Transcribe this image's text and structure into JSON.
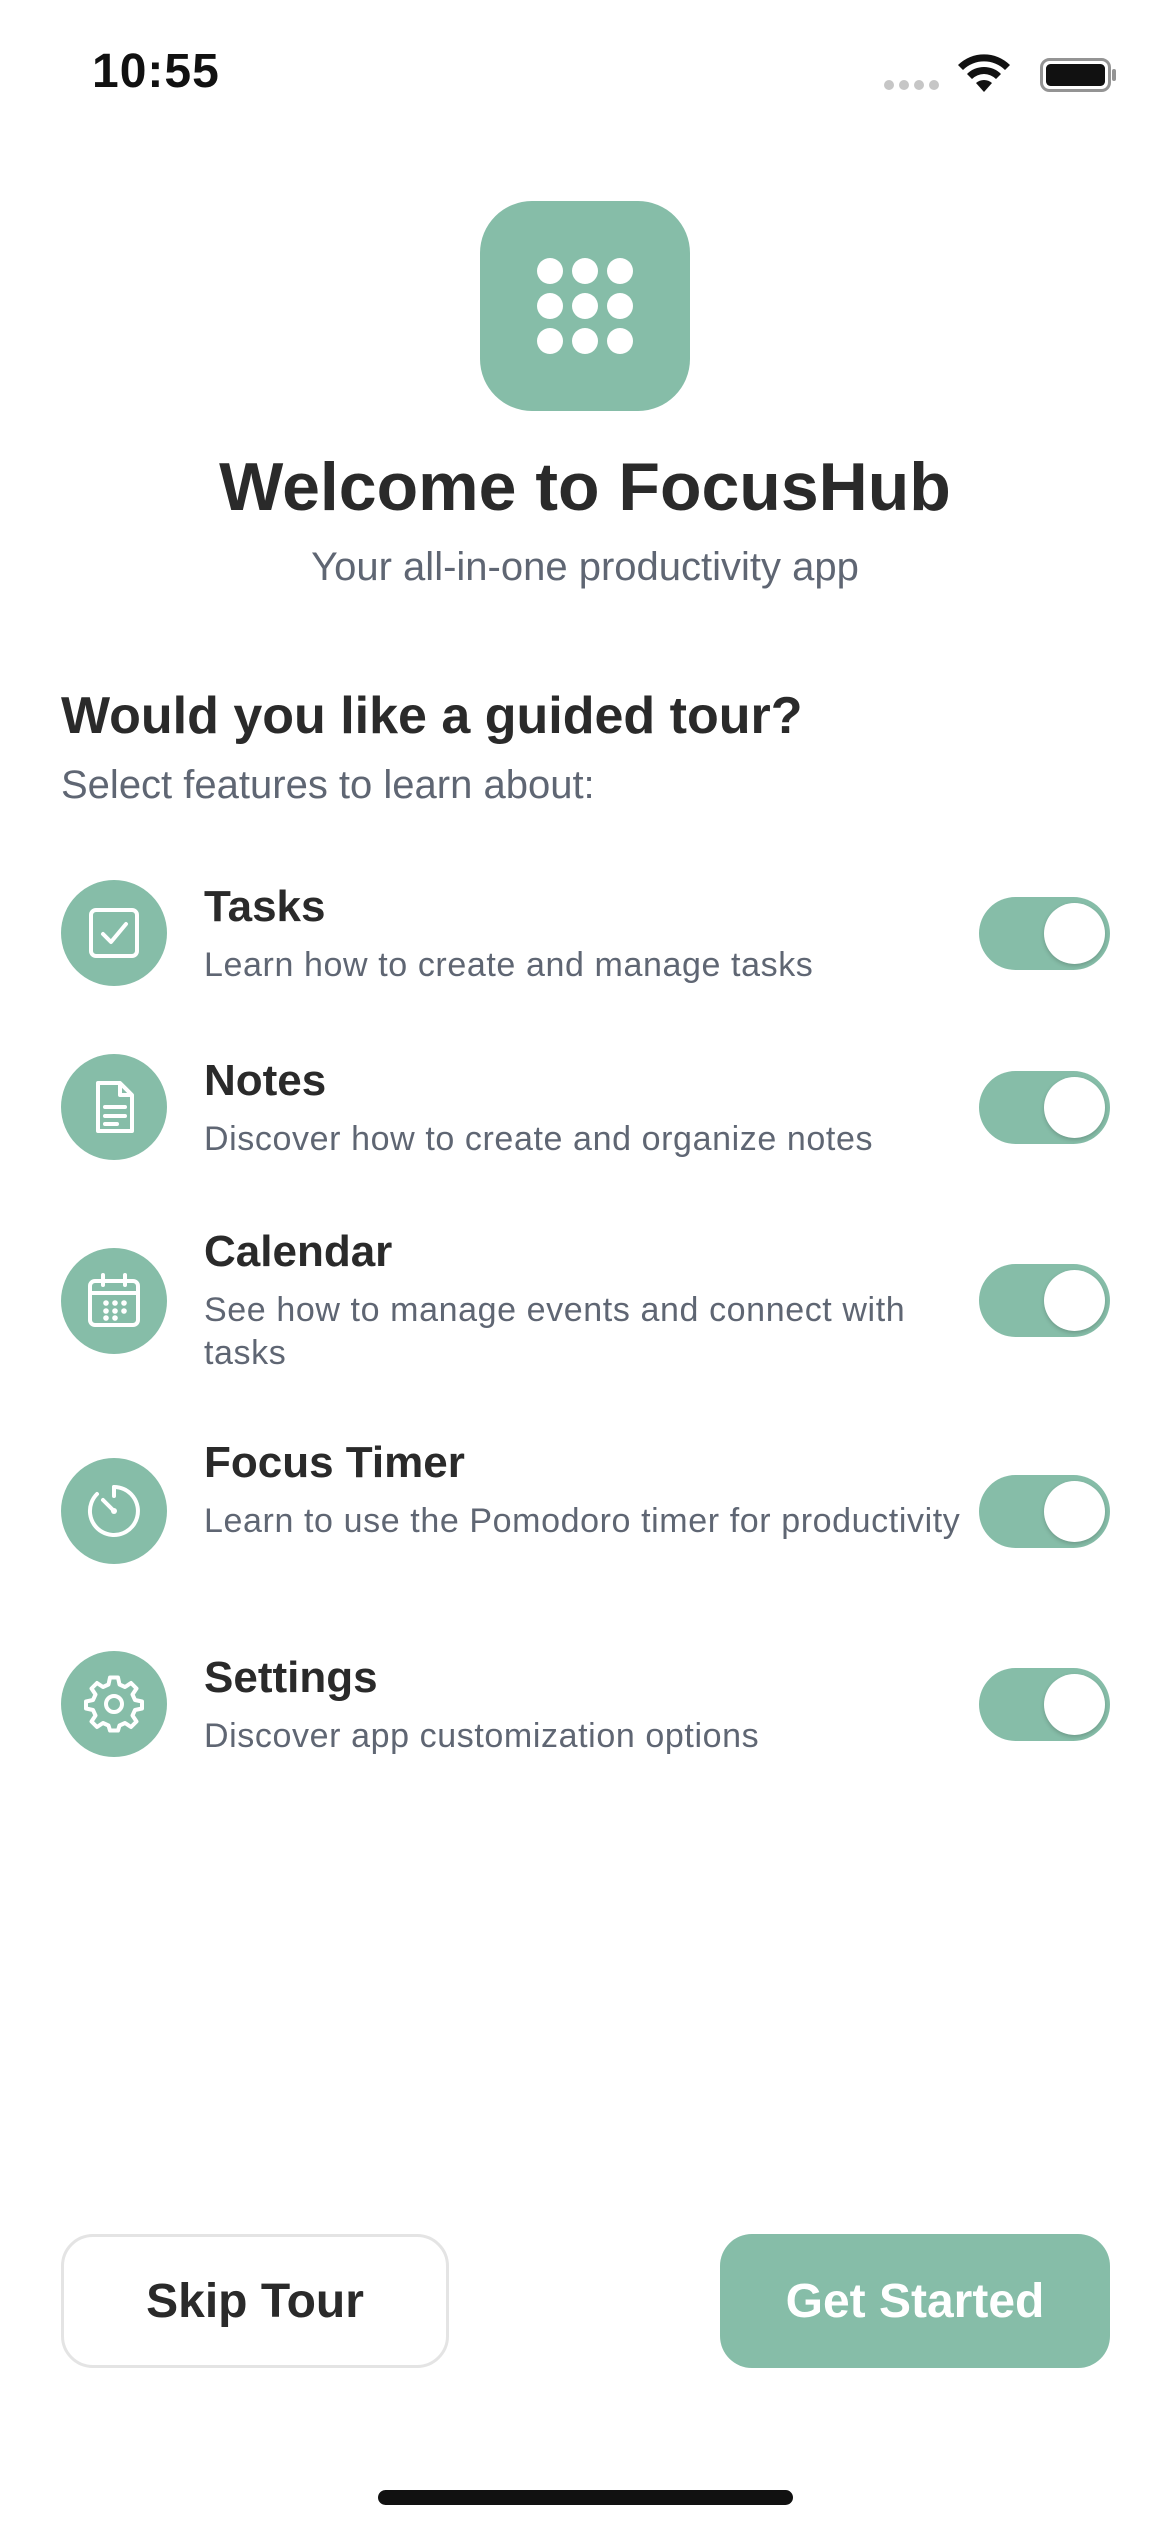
{
  "status_bar": {
    "time": "10:55",
    "icons": [
      "cellular-signal-icon",
      "wifi-icon",
      "battery-icon"
    ]
  },
  "app": {
    "logo_icon": "app-grid-icon",
    "title": "Welcome to FocusHub",
    "subtitle": "Your all-in-one productivity app"
  },
  "tour": {
    "heading": "Would you like a guided tour?",
    "subheading": "Select features to learn about:"
  },
  "features": [
    {
      "icon": "checkbox-icon",
      "title": "Tasks",
      "description": "Learn how to create and manage tasks",
      "enabled": true
    },
    {
      "icon": "document-icon",
      "title": "Notes",
      "description": "Discover how to create and organize notes",
      "enabled": true
    },
    {
      "icon": "calendar-icon",
      "title": "Calendar",
      "description": "See how to manage events and connect with tasks",
      "enabled": true
    },
    {
      "icon": "timer-icon",
      "title": "Focus Timer",
      "description": "Learn to use the Pomodoro timer for productivity",
      "enabled": true
    },
    {
      "icon": "gear-icon",
      "title": "Settings",
      "description": "Discover app customization options",
      "enabled": true
    }
  ],
  "actions": {
    "skip_label": "Skip Tour",
    "start_label": "Get Started"
  },
  "colors": {
    "accent": "#86bda8",
    "title_text": "#2a2a2a",
    "secondary_text": "#5f6673"
  }
}
